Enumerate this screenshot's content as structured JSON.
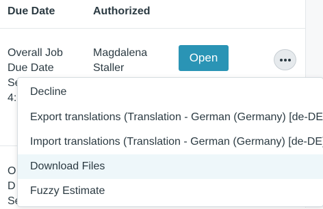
{
  "table": {
    "headers": {
      "due_date": "Due Date",
      "authorized": "Authorized"
    },
    "rows": [
      {
        "due_line1": "Overall Job",
        "due_line2": "Due Date",
        "due_line3": "Se",
        "due_line4": "4:",
        "authorized_line1": "Magdalena",
        "authorized_line2": "Staller",
        "action_label": "Open",
        "more_icon": "ellipsis-icon"
      },
      {
        "due_line1": "O",
        "due_line2": "D",
        "due_line3": "Se"
      }
    ]
  },
  "menu": {
    "items": [
      "Decline",
      "Export translations (Translation - German (Germany) [de-DE])",
      "Import translations (Translation - German (Germany) [de-DE])",
      "Download Files",
      "Fuzzy Estimate"
    ],
    "highlighted_index": 3
  },
  "colors": {
    "primary_button": "#2a94b5",
    "text": "#2b3a42",
    "hover_bg": "#eef7fa"
  }
}
